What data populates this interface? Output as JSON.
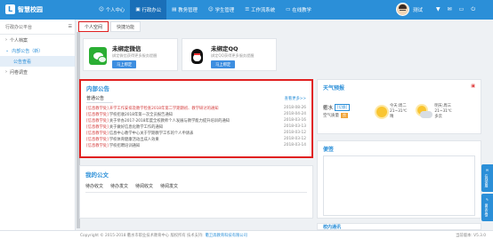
{
  "app": {
    "title": "智慧校园",
    "logo_char": "L"
  },
  "nav": [
    {
      "label": "个人中心",
      "icon": "user-icon",
      "glyph": "☺",
      "active": false
    },
    {
      "label": "行政办公",
      "icon": "building-icon",
      "glyph": "▣",
      "active": true
    },
    {
      "label": "教务管理",
      "icon": "book-icon",
      "glyph": "▤",
      "active": false
    },
    {
      "label": "学生管理",
      "icon": "students-icon",
      "glyph": "☺",
      "active": false
    },
    {
      "label": "工作流系统",
      "icon": "workflow-icon",
      "glyph": "☰",
      "active": false
    },
    {
      "label": "在线教学",
      "icon": "monitor-icon",
      "glyph": "▭",
      "active": false
    }
  ],
  "user": {
    "name": "测试"
  },
  "top_tools": [
    "bell-icon",
    "mail-icon",
    "monitor-icon",
    "power-icon"
  ],
  "sidebar": {
    "header": "行政办公平台",
    "items": [
      {
        "label": "个人档案",
        "state": "collapsed"
      },
      {
        "label": "内部公告（新）",
        "state": "expanded"
      },
      {
        "label": "问卷调查",
        "state": "collapsed"
      }
    ],
    "subitems": [
      {
        "label": "公告查看"
      }
    ]
  },
  "tabs": [
    {
      "label": "个人空间",
      "active": true
    },
    {
      "label": "快捷功能",
      "active": false
    }
  ],
  "binding": {
    "wechat": {
      "title": "未绑定微信",
      "hint": "绑定微信获得更多服务提醒",
      "button": "马上绑定"
    },
    "qq": {
      "title": "未绑定QQ",
      "hint": "绑定QQ获得更多服务提醒",
      "button": "马上绑定"
    }
  },
  "announcements": {
    "title": "内部公告",
    "subtitle": "普通公告",
    "more": "查看更多>>",
    "items": [
      {
        "tag": "[信息教学处]",
        "text": "开学工作安排及教学检查2018年第二学期期初、教学研讨的通知",
        "date": "2018-08-26",
        "highlight": true
      },
      {
        "tag": "[信息教学处]",
        "text": "学校招收2018年第一次全员报告通知",
        "date": "2018-04-24",
        "highlight": false
      },
      {
        "tag": "[信息教学处]",
        "text": "关于举办2017-2018年度全校教师个人发展与教学能力提升培训的通知",
        "date": "2018-03-16",
        "highlight": false
      },
      {
        "tag": "[信息教学处]",
        "text": "关于做好信息化教学工作的通知",
        "date": "2018-03-13",
        "highlight": false
      },
      {
        "tag": "[信息教学处]",
        "text": "信息中心教学中心关于学期教学工作的个人申请表",
        "date": "2018-03-12",
        "highlight": false
      },
      {
        "tag": "[信息教学处]",
        "text": "学校体育健康活动出成人效果",
        "date": "2018-03-12",
        "highlight": false
      },
      {
        "tag": "[信息教学处]",
        "text": "学校招聘培训通知",
        "date": "2018-03-14",
        "highlight": false
      }
    ]
  },
  "documents": {
    "title": "我的公文",
    "tabs": [
      "待办收文",
      "待办发文",
      "待阅收文",
      "待阅发文"
    ]
  },
  "weather": {
    "title": "天气预报",
    "city": "衢水",
    "switch": "[切换]",
    "aq_label": "空气质量",
    "aq_value": "良",
    "today": {
      "label": "今天:周二",
      "temp": "21~31℃",
      "desc": "晴"
    },
    "tomorrow": {
      "label": "明天:周三",
      "temp": "21~31℃",
      "desc": "多云"
    }
  },
  "notes": {
    "title": "便签"
  },
  "bottom_panel": {
    "title": "校内通讯"
  },
  "float_buttons": [
    {
      "label": "在线客服",
      "icon": "chat-icon"
    },
    {
      "label": "意见反馈",
      "icon": "feedback-icon"
    }
  ],
  "footer": {
    "copyright": "Copyright © 2015-2018  衢水市职业技术教育中心 版权所有  技术支持:",
    "vendor": "衢卫高教育科技有限公司",
    "version": "当前版本: V5.3.0"
  }
}
